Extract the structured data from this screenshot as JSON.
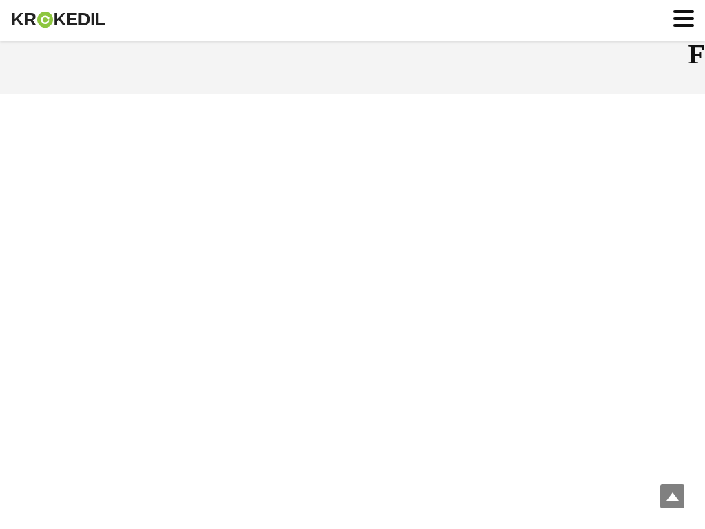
{
  "header": {
    "logo": {
      "text_start": "KR",
      "text_end": "KEDIL"
    }
  },
  "page_title": {
    "text": "F"
  }
}
